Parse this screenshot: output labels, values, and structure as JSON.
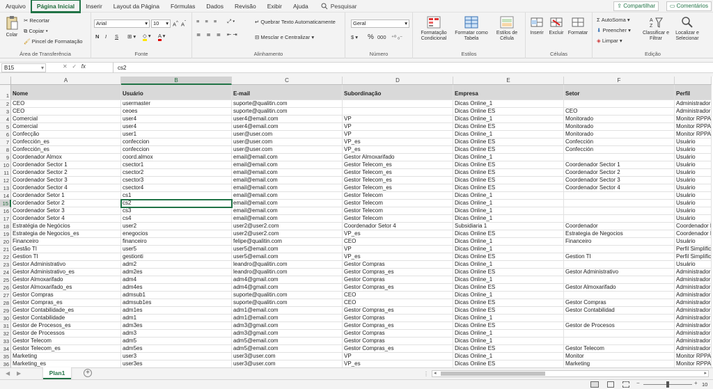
{
  "menu": {
    "tabs": [
      "Arquivo",
      "Página Inicial",
      "Inserir",
      "Layout da Página",
      "Fórmulas",
      "Dados",
      "Revisão",
      "Exibir",
      "Ajuda"
    ],
    "search": "Pesquisar",
    "share": "Compartilhar",
    "comments": "Comentários"
  },
  "ribbon": {
    "clipboard": {
      "paste": "Colar",
      "cut": "Recortar",
      "copy": "Copiar",
      "painter": "Pincel de Formatação",
      "label": "Área de Transferência"
    },
    "font": {
      "name": "Arial",
      "size": "10",
      "label": "Fonte",
      "bold": "N",
      "italic": "I",
      "underline": "S"
    },
    "alignment": {
      "wrap": "Quebrar Texto Automaticamente",
      "merge": "Mesclar e Centralizar",
      "label": "Alinhamento"
    },
    "number": {
      "format": "Geral",
      "pct": "%",
      "thousands": "000",
      "label": "Número"
    },
    "styles": {
      "cond": "Formatação Condicional",
      "table": "Formatar como Tabela",
      "cell": "Estilos de Célula",
      "label": "Estilos"
    },
    "cells": {
      "insert": "Inserir",
      "delete": "Excluir",
      "format": "Formatar",
      "label": "Células"
    },
    "editing": {
      "autosum": "AutoSoma",
      "fill": "Preencher",
      "clear": "Limpar",
      "sort": "Classificar e Filtrar",
      "find": "Localizar e Selecionar",
      "label": "Edição"
    }
  },
  "formula": {
    "namebox": "B15",
    "value": "cs2",
    "fx": "fx"
  },
  "columns": [
    "A",
    "B",
    "C",
    "D",
    "E",
    "F",
    ""
  ],
  "header": [
    "Nome",
    "Usuário",
    "E-mail",
    "Subordinação",
    "Empresa",
    "Setor",
    "Perfil"
  ],
  "rows": [
    [
      "CEO",
      "usermaster",
      "suporte@qualitin.com",
      "",
      "Dicas Online_1",
      "",
      "Administrador"
    ],
    [
      "CEO",
      "ceoes",
      "suporte@qualitin.com",
      "",
      "Dicas Online ES",
      "CEO",
      "Administrador"
    ],
    [
      "Comercial",
      "user4",
      "user4@email.com",
      "VP",
      "Dicas Online_1",
      "Monitorado",
      "Monitor RPPA"
    ],
    [
      "Comercial",
      "user4",
      "user4@email.com",
      "VP",
      "Dicas Online ES",
      "Monitorado",
      "Monitor RPPA"
    ],
    [
      "Confecção",
      "user1",
      "user@user.com",
      "VP",
      "Dicas Online_1",
      "Monitorado",
      "Monitor RPPA"
    ],
    [
      "Confección_es",
      "confeccion",
      "user@user.com",
      "VP_es",
      "Dicas Online ES",
      "Confección",
      "Usuário"
    ],
    [
      "Confección_es",
      "confeccion",
      "user@user.com",
      "VP_es",
      "Dicas Online ES",
      "Confección",
      "Usuário"
    ],
    [
      "Coordenador Almox",
      "coord.almox",
      "email@email.com",
      "Gestor Almoxarifado",
      "Dicas Online_1",
      "",
      "Usuário"
    ],
    [
      "Coordenador Sector 1",
      "csector1",
      "email@email.com",
      "Gestor Telecom_es",
      "Dicas Online ES",
      "Coordenador Sector 1",
      "Usuário"
    ],
    [
      "Coordenador Sector 2",
      "csector2",
      "email@email.com",
      "Gestor Telecom_es",
      "Dicas Online ES",
      "Coordenador Sector 2",
      "Usuário"
    ],
    [
      "Coordenador Sector 3",
      "csector3",
      "email@email.com",
      "Gestor Telecom_es",
      "Dicas Online ES",
      "Coordenador Sector 3",
      "Usuário"
    ],
    [
      "Coordenador Sector 4",
      "csector4",
      "email@email.com",
      "Gestor Telecom_es",
      "Dicas Online ES",
      "Coordenador Sector 4",
      "Usuário"
    ],
    [
      "Coordenador Setor 1",
      "cs1",
      "email@email.com",
      "Gestor Telecom",
      "Dicas Online_1",
      "",
      "Usuário"
    ],
    [
      "Coordenador Setor 2",
      "cs2",
      "email@email.com",
      "Gestor Telecom",
      "Dicas Online_1",
      "",
      "Usuário"
    ],
    [
      "Coordenador Setor 3",
      "cs3",
      "email@email.com",
      "Gestor Telecom",
      "Dicas Online_1",
      "",
      "Usuário"
    ],
    [
      "Coordenador Setor 4",
      "cs4",
      "email@email.com",
      "Gestor Telecom",
      "Dicas Online_1",
      "",
      "Usuário"
    ],
    [
      "Estratégia de Negócios",
      "user2",
      "user2@user2.com",
      "Coordenador Setor 4",
      "Subsidiaria 1",
      "Coordenador",
      "Coordenador R"
    ],
    [
      "Estrategia de Negocios_es",
      "enegocios",
      "user2@user2.com",
      "VP_es",
      "Dicas Online ES",
      "Estrategia de Negocios",
      "Coordenador R"
    ],
    [
      "Financeiro",
      "financeiro",
      "felipe@qualitin.com",
      "CEO",
      "Dicas Online_1",
      "Financeiro",
      "Usuário"
    ],
    [
      "Gestão TI",
      "user5",
      "user5@email.com",
      "VP",
      "Dicas Online_1",
      "",
      "Perfil Simplific"
    ],
    [
      "Gestion TI",
      "gestionti",
      "user5@email.com",
      "VP_es",
      "Dicas Online ES",
      "Gestion TI",
      "Perfil Simplific"
    ],
    [
      "Gestor Administrativo",
      "adm2",
      "leandro@qualitin.com",
      "Gestor Compras",
      "Dicas Online_1",
      "",
      "Usuário"
    ],
    [
      "Gestor Administrativo_es",
      "adm2es",
      "leandro@qualitin.com",
      "Gestor Compras_es",
      "Dicas Online ES",
      "Gestor Administrativo",
      "Administrador"
    ],
    [
      "Gestor Almoxarifado",
      "adm4",
      "adm4@gmail.com",
      "Gestor Compras",
      "Dicas Online_1",
      "",
      "Administrador"
    ],
    [
      "Gestor Almoxarifado_es",
      "adm4es",
      "adm4@gmail.com",
      "Gestor Compras_es",
      "Dicas Online ES",
      "Gestor Almoxarifado",
      "Administrador"
    ],
    [
      "Gestor Compras",
      "admsub1",
      "suporte@qualitin.com",
      "CEO",
      "Dicas Online_1",
      "",
      "Administrador"
    ],
    [
      "Gestor Compras_es",
      "admsub1es",
      "suporte@qualitin.com",
      "CEO",
      "Dicas Online ES",
      "Gestor Compras",
      "Administrador"
    ],
    [
      "Gestor Contabilidade_es",
      "adm1es",
      "adm1@email.com",
      "Gestor Compras_es",
      "Dicas Online ES",
      "Gestor Contabilidad",
      "Administrador"
    ],
    [
      "Gestor Contabilidade",
      "adm1",
      "adm1@email.com",
      "Gestor Compras",
      "Dicas Online_1",
      "",
      "Administrador"
    ],
    [
      "Gestor de Procesos_es",
      "adm3es",
      "adm3@gmail.com",
      "Gestor Compras_es",
      "Dicas Online ES",
      "Gestor de Procesos",
      "Administrador"
    ],
    [
      "Gestor de Processos",
      "adm3",
      "adm3@gmail.com",
      "Gestor Compras",
      "Dicas Online_1",
      "",
      "Administrador"
    ],
    [
      "Gestor Telecom",
      "adm5",
      "adm5@email.com",
      "Gestor Compras",
      "Dicas Online_1",
      "",
      "Administrador"
    ],
    [
      "Gestor Telecom_es",
      "adm5es",
      "adm5@email.com",
      "Gestor Compras_es",
      "Dicas Online ES",
      "Gestor Telecom",
      "Administrador"
    ],
    [
      "Marketing",
      "user3",
      "user3@user.com",
      "VP",
      "Dicas Online_1",
      "Monitor",
      "Monitor RPPA"
    ],
    [
      "Marketing_es",
      "user3es",
      "user3@user.com",
      "VP_es",
      "Dicas Online ES",
      "Marketing",
      "Monitor RPPA"
    ]
  ],
  "sheet": {
    "tab": "Plan1",
    "add": "+"
  },
  "status": {
    "zoom": "10"
  }
}
